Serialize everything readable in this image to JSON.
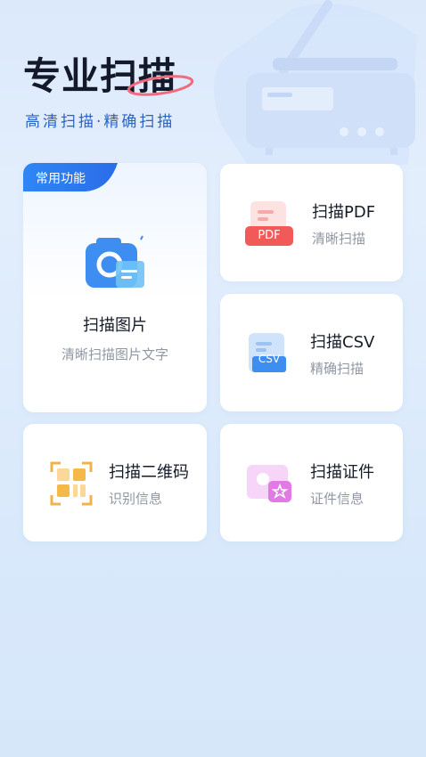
{
  "hero": {
    "title": "专业扫描",
    "subtitle": "高清扫描·精确扫描"
  },
  "features": {
    "scan_image": {
      "badge": "常用功能",
      "title": "扫描图片",
      "subtitle": "清晰扫描图片文字",
      "icon": "camera-scan-icon"
    },
    "scan_pdf": {
      "title": "扫描PDF",
      "subtitle": "清晰扫描",
      "icon_label": "PDF",
      "icon": "pdf-file-icon"
    },
    "scan_csv": {
      "title": "扫描CSV",
      "subtitle": "精确扫描",
      "icon_label": "CSV",
      "icon": "csv-file-icon"
    },
    "scan_qr": {
      "title": "扫描二维码",
      "subtitle": "识别信息",
      "icon": "qr-code-icon"
    },
    "scan_id": {
      "title": "扫描证件",
      "subtitle": "证件信息",
      "icon": "id-card-icon"
    }
  },
  "colors": {
    "accent": "#2a63c7",
    "badge": "#2b7bf0",
    "pdf": "#f25a5a",
    "csv": "#3d8ef0",
    "qr": "#f2b24a",
    "id": "#e27ae6"
  }
}
